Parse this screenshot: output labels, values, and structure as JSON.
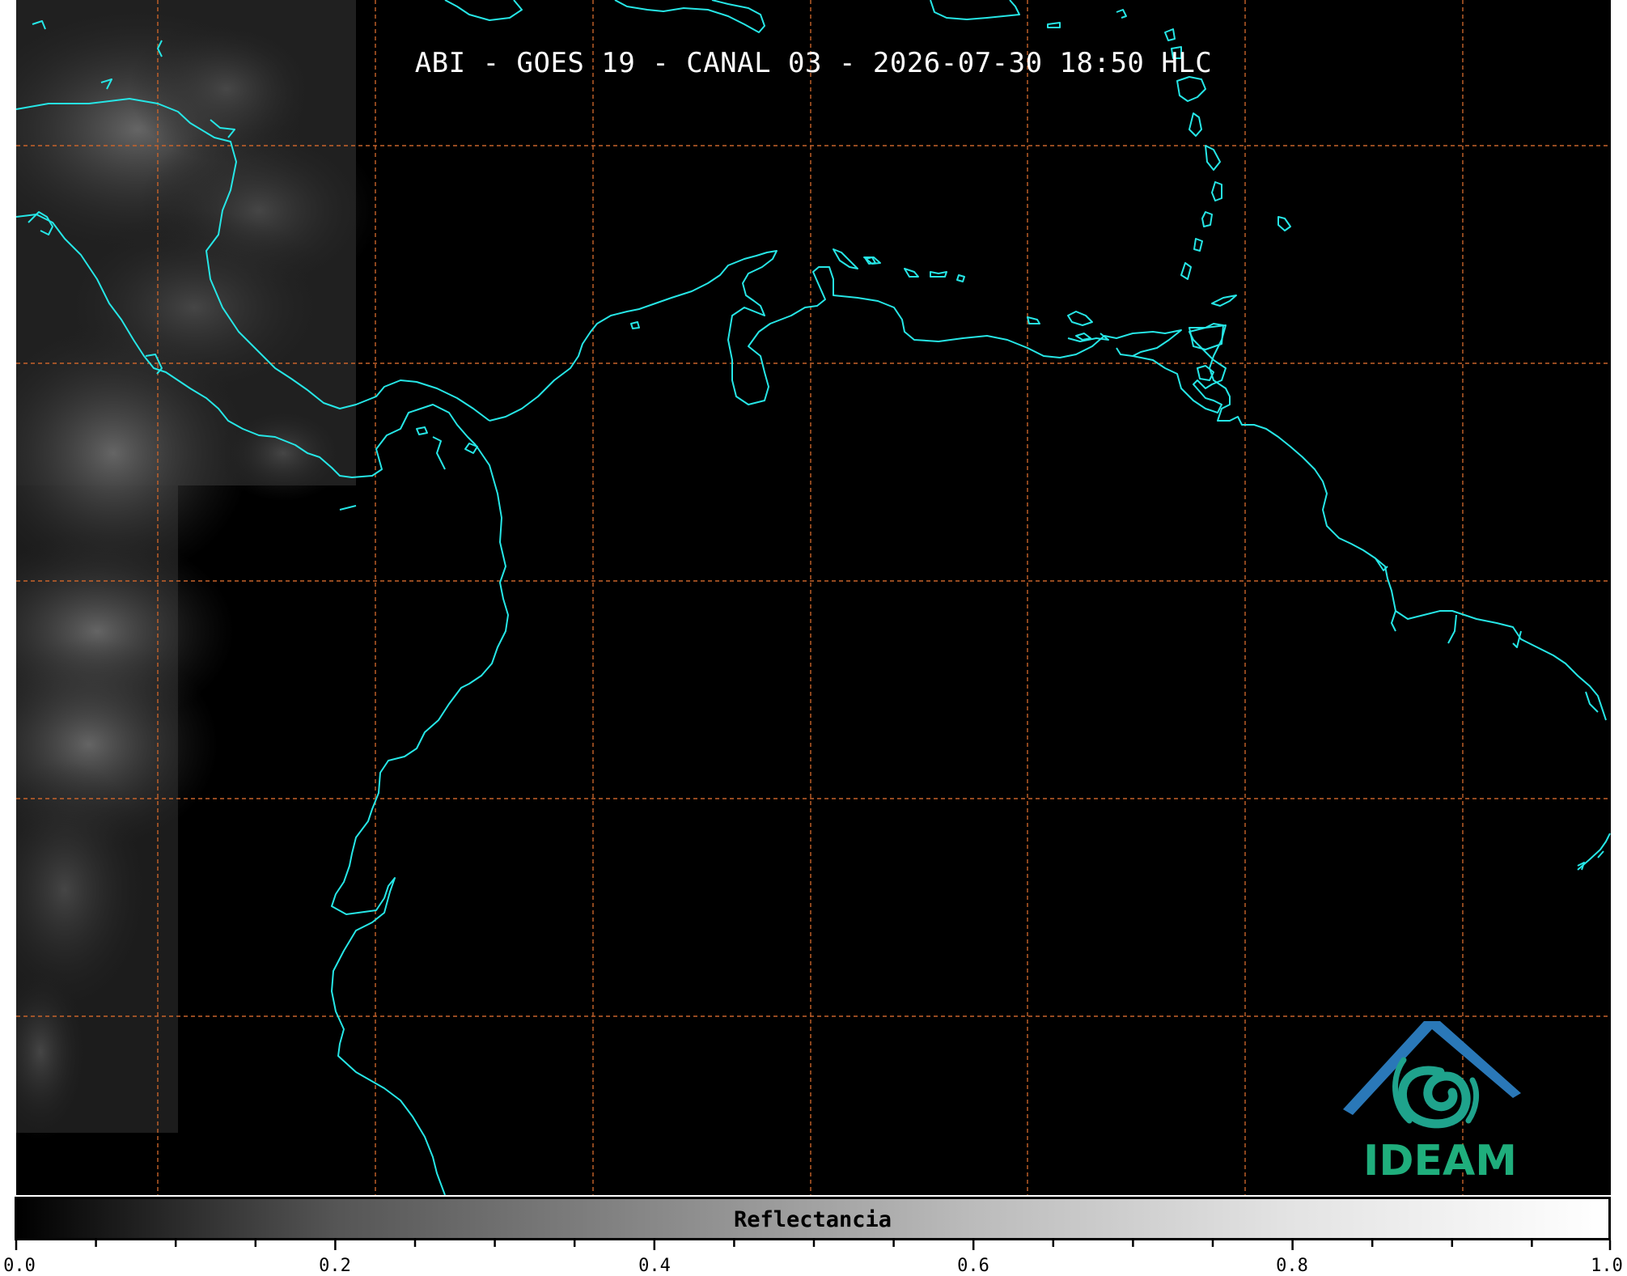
{
  "title": "ABI - GOES 19 - CANAL 03 - 2026-07-30 18:50 HLC",
  "logo": {
    "text": "IDEAM",
    "colors": {
      "roof": "#2a78b8",
      "swirl": "#1fa38c",
      "text": "#1fae7c"
    }
  },
  "colorbar": {
    "label": "Reflectancia",
    "range": [
      0.0,
      1.0
    ],
    "ticks": [
      "0.0",
      "0.2",
      "0.4",
      "0.6",
      "0.8",
      "1.0"
    ],
    "colormap": "grayscale"
  },
  "colors": {
    "background": "#000000",
    "coastline": "#26e6e6",
    "graticule": "#c8632a"
  }
}
